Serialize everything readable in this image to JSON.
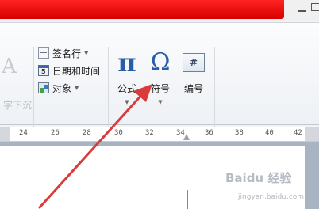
{
  "ribbon": {
    "faded_left_label": "字下沉",
    "commands": {
      "signature_line": "签名行",
      "date_time": "日期和时间",
      "object": "对象"
    },
    "formula_label": "公式",
    "symbol_label": "符号",
    "number_label": "编号",
    "symbols_group_label": "符号",
    "icons": {
      "pi_glyph": "π",
      "omega_glyph": "Ω",
      "number_glyph": "#"
    }
  },
  "ruler": {
    "marks": [
      "24",
      "26",
      "28",
      "30",
      "32",
      "34",
      "36",
      "38",
      "40",
      "42"
    ]
  },
  "watermark": {
    "brand": "Baidu 经验",
    "url": "jingyan.baidu.com"
  },
  "colors": {
    "titlebar_red": "#e00000",
    "arrow_red": "#d93a3a",
    "ribbon_bg": "#f4f6f9",
    "page_bg": "#ffffff"
  }
}
